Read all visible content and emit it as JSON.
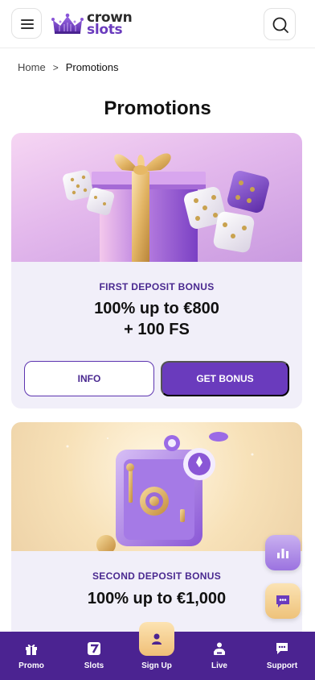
{
  "header": {
    "logo_line1": "crown",
    "logo_line2": "slots",
    "menu_icon": "hamburger-menu-icon",
    "search_icon": "search-icon"
  },
  "breadcrumb": {
    "home": "Home",
    "separator": ">",
    "current": "Promotions"
  },
  "page_title": "Promotions",
  "promos": [
    {
      "subtitle": "FIRST DEPOSIT BONUS",
      "title_line1": "100% up to €800",
      "title_line2": "+ 100 FS",
      "info_label": "INFO",
      "get_label": "GET BONUS",
      "image": "gift-box-and-dice-illustration"
    },
    {
      "subtitle": "SECOND DEPOSIT BONUS",
      "title_line1": "100% up to €1,000",
      "image": "purple-safe-with-chips-illustration"
    }
  ],
  "floating": {
    "top_icon": "bar-chart-icon",
    "chat_icon": "chat-icon"
  },
  "bottom_nav": [
    {
      "label": "Promo",
      "icon": "gift-icon"
    },
    {
      "label": "Slots",
      "icon": "slot-seven-icon"
    },
    {
      "label": "Sign Up",
      "icon": "user-icon"
    },
    {
      "label": "Live",
      "icon": "live-dealer-icon"
    },
    {
      "label": "Support",
      "icon": "chat-support-icon"
    }
  ],
  "colors": {
    "brand_purple": "#6a3bbd",
    "nav_purple": "#4b2391",
    "accent_gold": "#f0bf77"
  }
}
